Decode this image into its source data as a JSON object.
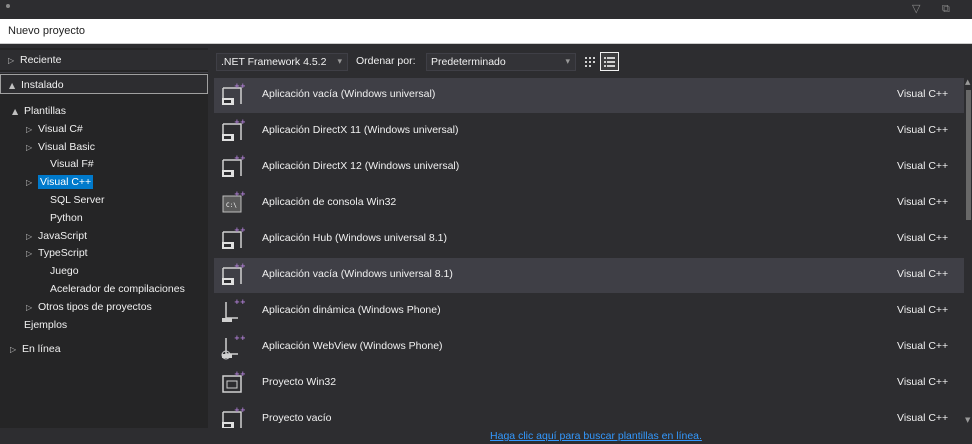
{
  "window": {
    "title": "Nuevo proyecto",
    "controls": [
      "chevron-down-icon",
      "restore-icon"
    ]
  },
  "sidebar": {
    "recent": "Reciente",
    "installed": "Instalado",
    "online": "En línea",
    "tree": [
      {
        "label": "Plantillas",
        "arrow": "▲",
        "highlight": false
      },
      {
        "label": "Visual C#",
        "arrow": "▷",
        "highlight": false
      },
      {
        "label": "Visual Basic",
        "arrow": "▷",
        "highlight": false
      },
      {
        "label": "Visual F#",
        "arrow": "",
        "highlight": false
      },
      {
        "label": "Visual C++",
        "arrow": "▷",
        "highlight": true
      },
      {
        "label": "SQL Server",
        "arrow": "",
        "highlight": false
      },
      {
        "label": "Python",
        "arrow": "",
        "highlight": false
      },
      {
        "label": "JavaScript",
        "arrow": "▷",
        "highlight": false
      },
      {
        "label": "TypeScript",
        "arrow": "▷",
        "highlight": false
      },
      {
        "label": "Juego",
        "arrow": "",
        "highlight": false
      },
      {
        "label": "Acelerador de compilaciones",
        "arrow": "",
        "highlight": false
      },
      {
        "label": "Otros tipos de proyectos",
        "arrow": "▷",
        "highlight": false
      },
      {
        "label": "Ejemplos",
        "arrow": "",
        "highlight": false
      }
    ]
  },
  "toolbar": {
    "framework": ".NET Framework 4.5.2",
    "sort_label": "Ordenar por:",
    "sort_value": "Predeterminado"
  },
  "templates": [
    {
      "name": "Aplicación vacía (Windows universal)",
      "lang": "Visual C++",
      "icon": "universal-app-icon",
      "hover": true
    },
    {
      "name": "Aplicación DirectX 11 (Windows universal)",
      "lang": "Visual C++",
      "icon": "universal-app-icon",
      "hover": false
    },
    {
      "name": "Aplicación DirectX 12 (Windows universal)",
      "lang": "Visual C++",
      "icon": "universal-app-icon",
      "hover": false
    },
    {
      "name": "Aplicación de consola Win32",
      "lang": "Visual C++",
      "icon": "console-app-icon",
      "hover": false
    },
    {
      "name": "Aplicación Hub (Windows universal 8.1)",
      "lang": "Visual C++",
      "icon": "hub-app-icon",
      "hover": false
    },
    {
      "name": "Aplicación vacía (Windows universal 8.1)",
      "lang": "Visual C++",
      "icon": "universal-app-icon",
      "hover": true
    },
    {
      "name": "Aplicación dinámica (Windows Phone)",
      "lang": "Visual C++",
      "icon": "phone-app-icon",
      "hover": false
    },
    {
      "name": "Aplicación WebView (Windows Phone)",
      "lang": "Visual C++",
      "icon": "phone-web-app-icon",
      "hover": false
    },
    {
      "name": "Proyecto Win32",
      "lang": "Visual C++",
      "icon": "win32-project-icon",
      "hover": false
    },
    {
      "name": "Proyecto vacío",
      "lang": "Visual C++",
      "icon": "empty-project-icon",
      "hover": false
    }
  ],
  "footer": {
    "link": "Haga clic aquí para buscar plantillas en línea."
  },
  "colors": {
    "accent": "#007acc",
    "link": "#3399ff",
    "background": "#2d2d30",
    "row_hover": "#3f3f46"
  }
}
